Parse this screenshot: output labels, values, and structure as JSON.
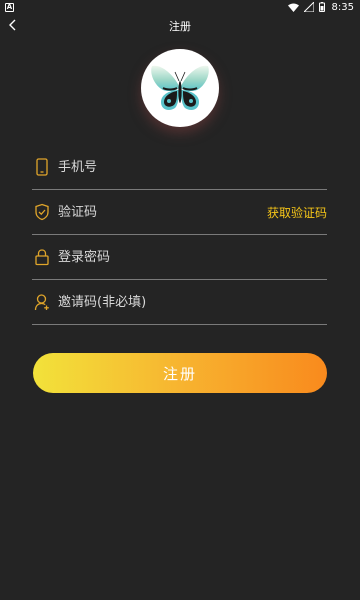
{
  "status_bar": {
    "left_badge": "A",
    "time": "8:35"
  },
  "nav": {
    "title": "注册"
  },
  "form": {
    "phone": {
      "placeholder": "手机号",
      "value": ""
    },
    "code": {
      "placeholder": "验证码",
      "value": "",
      "get_code_label": "获取验证码"
    },
    "password": {
      "placeholder": "登录密码",
      "value": ""
    },
    "invite": {
      "placeholder": "邀请码(非必填)",
      "value": ""
    },
    "submit_label": "注册"
  },
  "colors": {
    "background": "#242424",
    "accent": "#f5c518",
    "icon": "#e0a52a",
    "gradient_start": "#f2e23a",
    "gradient_end": "#f98a1d"
  },
  "icons": {
    "back": "chevron-left-icon",
    "phone": "phone-icon",
    "code": "shield-check-icon",
    "password": "lock-icon",
    "invite": "user-plus-icon"
  }
}
